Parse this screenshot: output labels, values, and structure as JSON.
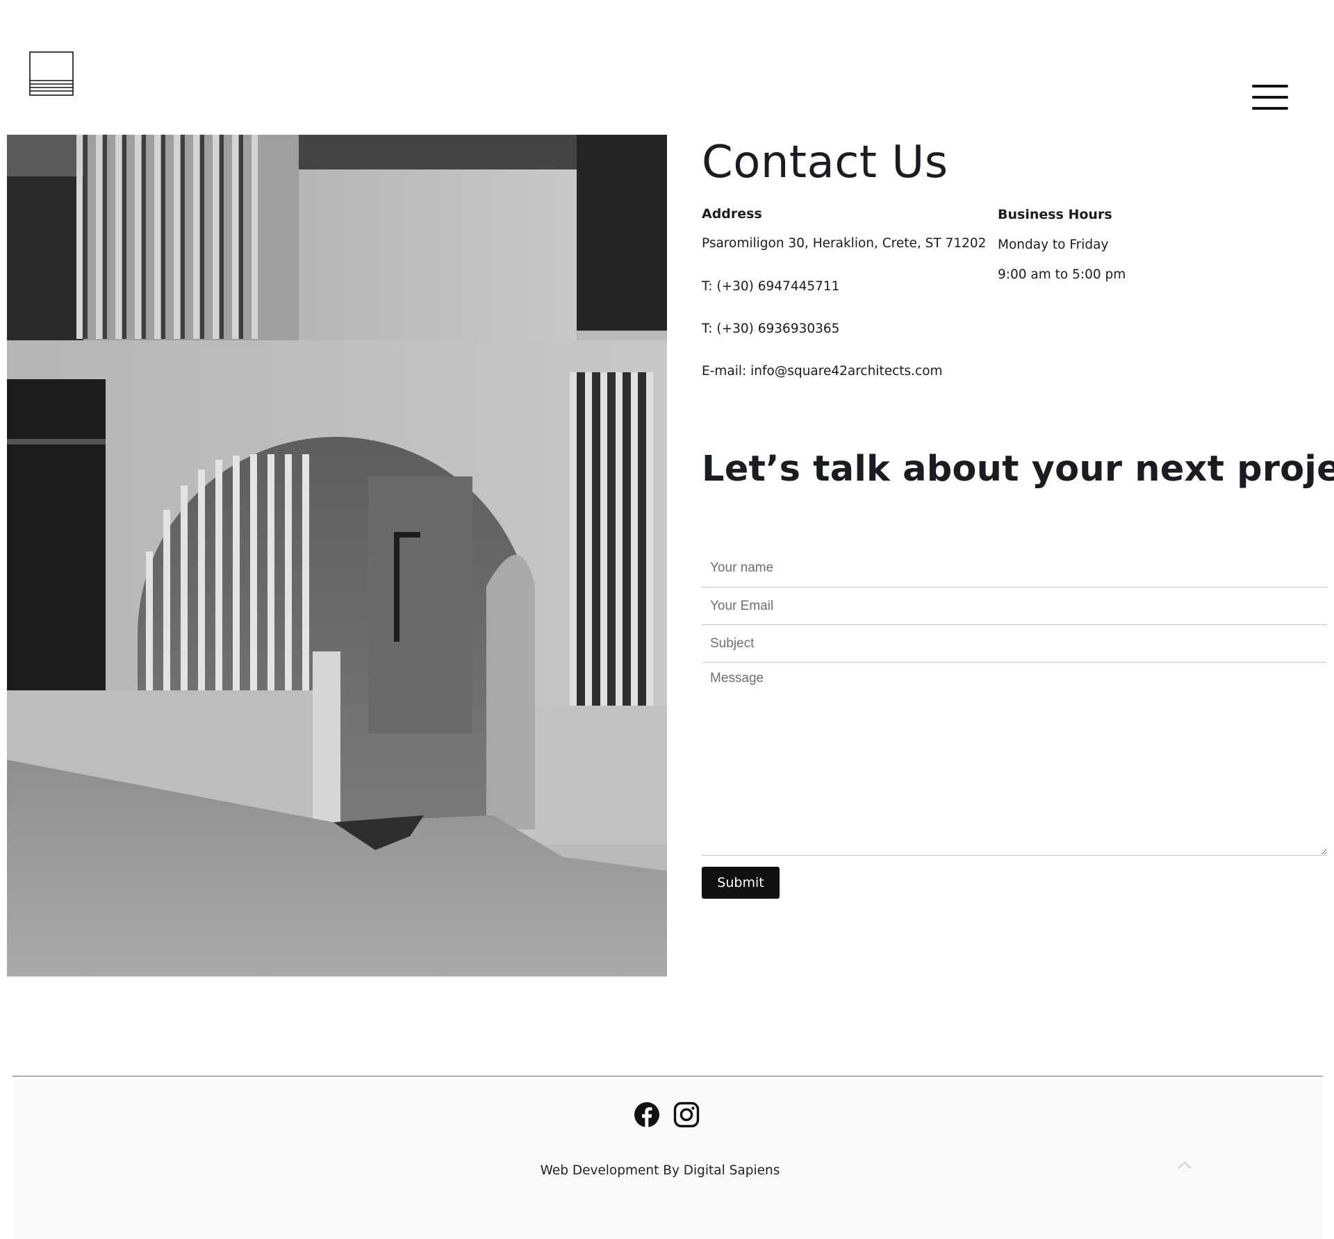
{
  "header": {
    "logo_icon": "square-striped-logo",
    "menu_icon": "hamburger-menu-icon"
  },
  "hero_image": {
    "description_icon": "architecture-photo"
  },
  "contact": {
    "title": "Contact Us",
    "address_heading": "Address",
    "address": "Psaromiligon 30, Heraklion, Crete, ST 71202",
    "phone_1": "T: (+30) 6947445711",
    "phone_2": "T: (+30) 6936930365",
    "email": "E-mail: info@square42architects.com",
    "hours_heading": "Business Hours",
    "hours_days": "Monday to Friday",
    "hours_time": "9:00 am to 5:00 pm"
  },
  "form": {
    "headline": "Let’s talk about your next project",
    "name_placeholder": "Your name",
    "email_placeholder": "Your Email",
    "subject_placeholder": "Subject",
    "message_placeholder": "Message",
    "submit_label": "Submit"
  },
  "footer": {
    "social": [
      "facebook-icon",
      "instagram-icon"
    ],
    "credit": "Web Development By Digital Sapiens",
    "back_to_top_icon": "chevron-up-icon"
  },
  "colors": {
    "text": "#1b1b22",
    "button_bg": "#111111",
    "footer_bg": "#fafafa",
    "field_border": "#c9c9c9"
  }
}
